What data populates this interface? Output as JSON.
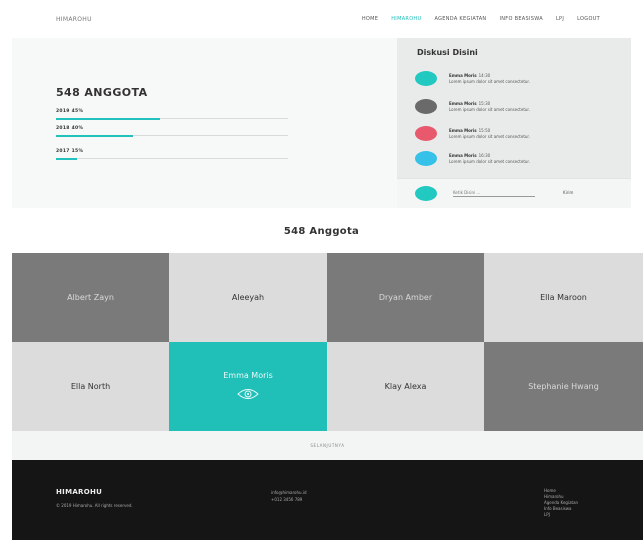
{
  "nav": {
    "brand": "HIMAROHU",
    "links": [
      "HOME",
      "HIMAROHU",
      "AGENDA KEGIATAN",
      "INFO BEASISWA",
      "LPJ",
      "LOGOUT"
    ],
    "active_index": 1,
    "accent_color": "#22c1bd"
  },
  "stats": {
    "title": "548 ANGGOTA",
    "items": [
      {
        "label": "2019 45%",
        "percent": 45
      },
      {
        "label": "2018 40%",
        "percent": 33
      },
      {
        "label": "2017 15%",
        "percent": 9
      }
    ]
  },
  "chat": {
    "title": "Diskusi Disini",
    "messages": [
      {
        "name": "Emma Moris",
        "time": "14:30",
        "text": "Lorem ipsum dolor sit amet consectetur.",
        "avatar_color": "#22c9c1"
      },
      {
        "name": "Emma Moris",
        "time": "15:30",
        "text": "Lorem ipsum dolor sit amet consectetur.",
        "avatar_color": "#6a6a6a"
      },
      {
        "name": "Emma Moris",
        "time": "15:50",
        "text": "Lorem ipsum dolor sit amet consectetur.",
        "avatar_color": "#e8596d"
      },
      {
        "name": "Emma Moris",
        "time": "16:30",
        "text": "Lorem ipsum dolor sit amet consectetur.",
        "avatar_color": "#36c1e8"
      }
    ],
    "composer": {
      "placeholder": "Ketik Disini ...",
      "send_label": "Kirim",
      "avatar_color": "#22c9c1"
    }
  },
  "members": {
    "heading": "548 Anggota",
    "tiles": [
      {
        "name": "Albert Zayn",
        "style": "dark"
      },
      {
        "name": "Aleeyah",
        "style": "light"
      },
      {
        "name": "Dryan Amber",
        "style": "dark"
      },
      {
        "name": "Ella Maroon",
        "style": "light"
      },
      {
        "name": "Ella North",
        "style": "light"
      },
      {
        "name": "Emma Moris",
        "style": "accent",
        "icon": "eye-icon"
      },
      {
        "name": "Klay Alexa",
        "style": "light"
      },
      {
        "name": "Stephanie Hwang",
        "style": "dark"
      }
    ],
    "more_label": "SELANJUTNYA"
  },
  "footer": {
    "brand": "HIMAROHU",
    "copyright": "© 2019 Himarohu. All rights reserved.",
    "email": "info@himarohu.id",
    "phone": "+012 3456 789",
    "links": [
      "Home",
      "Himarohu",
      "Agenda Kegiatan",
      "Info Beasiswa",
      "LPJ"
    ]
  }
}
